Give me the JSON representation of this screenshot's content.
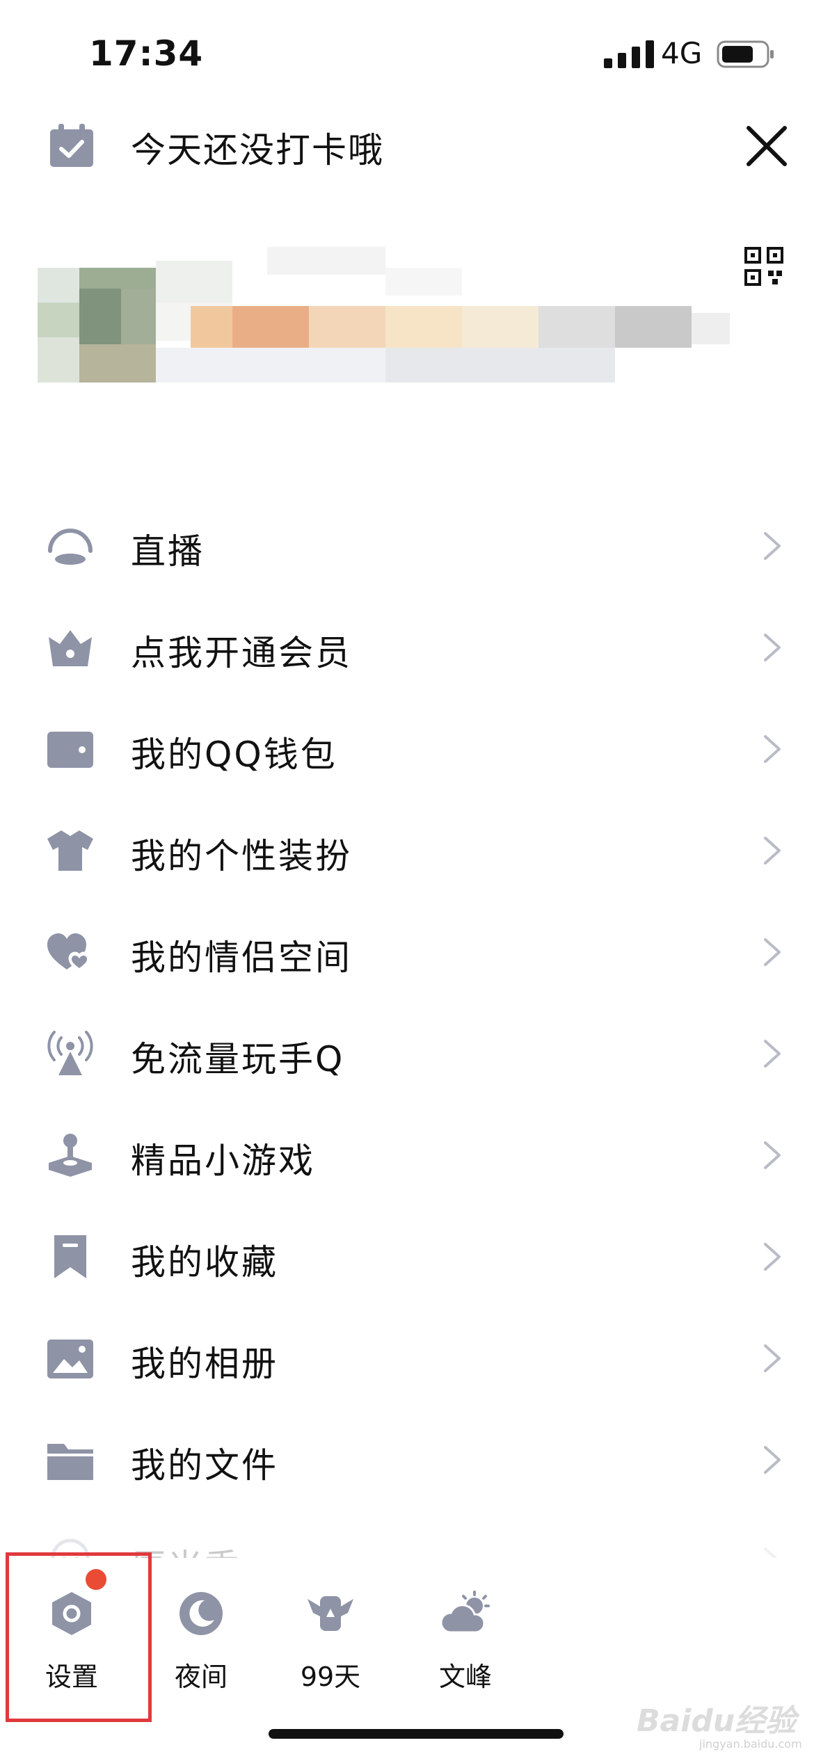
{
  "status_bar": {
    "time": "17:34",
    "network": "4G"
  },
  "header": {
    "checkin_text": "今天还没打卡哦"
  },
  "menu": {
    "items": [
      {
        "label": "直播",
        "icon": "live-icon"
      },
      {
        "label": "点我开通会员",
        "icon": "vip-crown-icon"
      },
      {
        "label": "我的QQ钱包",
        "icon": "wallet-icon"
      },
      {
        "label": "我的个性装扮",
        "icon": "tshirt-icon"
      },
      {
        "label": "我的情侣空间",
        "icon": "couple-hearts-icon"
      },
      {
        "label": "免流量玩手Q",
        "icon": "broadcast-tower-icon"
      },
      {
        "label": "精品小游戏",
        "icon": "joystick-icon"
      },
      {
        "label": "我的收藏",
        "icon": "bookmark-icon"
      },
      {
        "label": "我的相册",
        "icon": "photo-icon"
      },
      {
        "label": "我的文件",
        "icon": "folder-icon"
      },
      {
        "label": "厘米秀",
        "icon": "ghost-avatar-icon"
      }
    ]
  },
  "bottom_bar": {
    "settings": "设置",
    "night": "夜间",
    "days": "99天",
    "weather": "文峰"
  },
  "watermark": {
    "brand": "Baidu经验",
    "url": "jingyan.baidu.com"
  },
  "colors": {
    "icon_gray": "#8e93a6",
    "red_dot": "#ea4b35",
    "highlight_border": "#e0393d"
  }
}
